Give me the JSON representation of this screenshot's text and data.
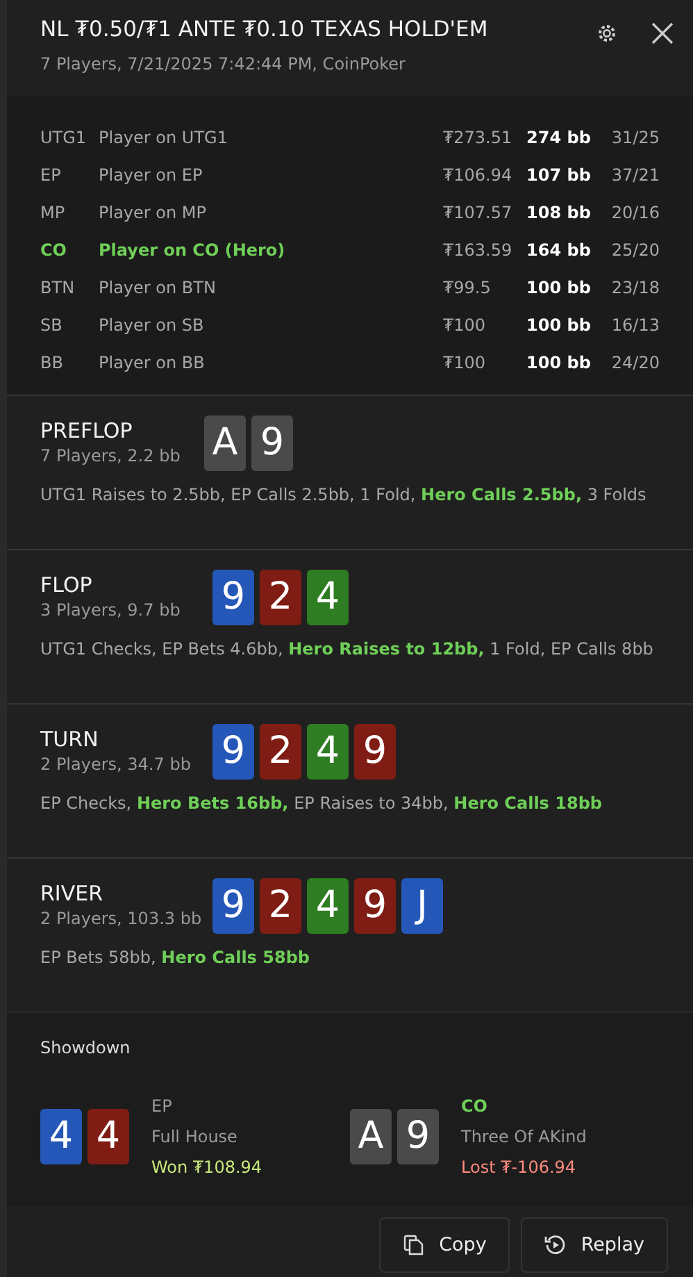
{
  "header": {
    "title": "NL ₮0.50/₮1 ANTE ₮0.10 TEXAS HOLD'EM",
    "subtitle": "7 Players, 7/21/2025 7:42:44 PM, CoinPoker"
  },
  "players": [
    {
      "position": "UTG1",
      "name": "Player on UTG1",
      "stack": "₮273.51",
      "bb": "274 bb",
      "stats": "31/25",
      "hero": false
    },
    {
      "position": "EP",
      "name": "Player on EP",
      "stack": "₮106.94",
      "bb": "107 bb",
      "stats": "37/21",
      "hero": false
    },
    {
      "position": "MP",
      "name": "Player on MP",
      "stack": "₮107.57",
      "bb": "108 bb",
      "stats": "20/16",
      "hero": false
    },
    {
      "position": "CO",
      "name": "Player on CO (Hero)",
      "stack": "₮163.59",
      "bb": "164 bb",
      "stats": "25/20",
      "hero": true
    },
    {
      "position": "BTN",
      "name": "Player on BTN",
      "stack": "₮99.5",
      "bb": "100 bb",
      "stats": "23/18",
      "hero": false
    },
    {
      "position": "SB",
      "name": "Player on SB",
      "stack": "₮100",
      "bb": "100 bb",
      "stats": "16/13",
      "hero": false
    },
    {
      "position": "BB",
      "name": "Player on BB",
      "stack": "₮100",
      "bb": "100 bb",
      "stats": "24/20",
      "hero": false
    }
  ],
  "streets": [
    {
      "name": "PREFLOP",
      "info": "7 Players, 2.2 bb",
      "cards": [
        {
          "rank": "A",
          "color": "#4a4a4a"
        },
        {
          "rank": "9",
          "color": "#4a4a4a"
        }
      ],
      "actions": "UTG1 Raises to 2.5bb, EP Calls 2.5bb, 1 Fold, **Hero Calls 2.5bb,** 3 Folds"
    },
    {
      "name": "FLOP",
      "info": "3 Players, 9.7 bb",
      "cards": [
        {
          "rank": "9",
          "color": "#2557b8"
        },
        {
          "rank": "2",
          "color": "#7f1d14"
        },
        {
          "rank": "4",
          "color": "#2f7d22"
        }
      ],
      "actions": "UTG1 Checks, EP Bets 4.6bb, **Hero Raises to 12bb,** 1 Fold, EP Calls 8bb"
    },
    {
      "name": "TURN",
      "info": "2 Players, 34.7 bb",
      "cards": [
        {
          "rank": "9",
          "color": "#2557b8"
        },
        {
          "rank": "2",
          "color": "#7f1d14"
        },
        {
          "rank": "4",
          "color": "#2f7d22"
        },
        {
          "rank": "9",
          "color": "#7f1d14"
        }
      ],
      "actions": "EP Checks, **Hero Bets 16bb,** EP Raises to 34bb, **Hero Calls 18bb**"
    },
    {
      "name": "RIVER",
      "info": "2 Players, 103.3 bb",
      "cards": [
        {
          "rank": "9",
          "color": "#2557b8"
        },
        {
          "rank": "2",
          "color": "#7f1d14"
        },
        {
          "rank": "4",
          "color": "#2f7d22"
        },
        {
          "rank": "9",
          "color": "#7f1d14"
        },
        {
          "rank": "J",
          "color": "#2557b8"
        }
      ],
      "actions": "EP Bets 58bb, **Hero Calls 58bb**"
    }
  ],
  "showdown": {
    "title": "Showdown",
    "hands": [
      {
        "cards": [
          {
            "rank": "4",
            "color": "#2557b8"
          },
          {
            "rank": "4",
            "color": "#7f1d14"
          }
        ],
        "position": "EP",
        "hero": false,
        "hand": "Full House",
        "result": "Won ₮108.94",
        "won": true
      },
      {
        "cards": [
          {
            "rank": "A",
            "color": "#4a4a4a"
          },
          {
            "rank": "9",
            "color": "#4a4a4a"
          }
        ],
        "position": "CO",
        "hero": true,
        "hand": "Three Of AKind",
        "result": "Lost ₮-106.94",
        "won": false
      }
    ]
  },
  "buttons": [
    {
      "kind": "copy",
      "label": "Copy"
    },
    {
      "kind": "replay",
      "label": "Replay"
    }
  ]
}
